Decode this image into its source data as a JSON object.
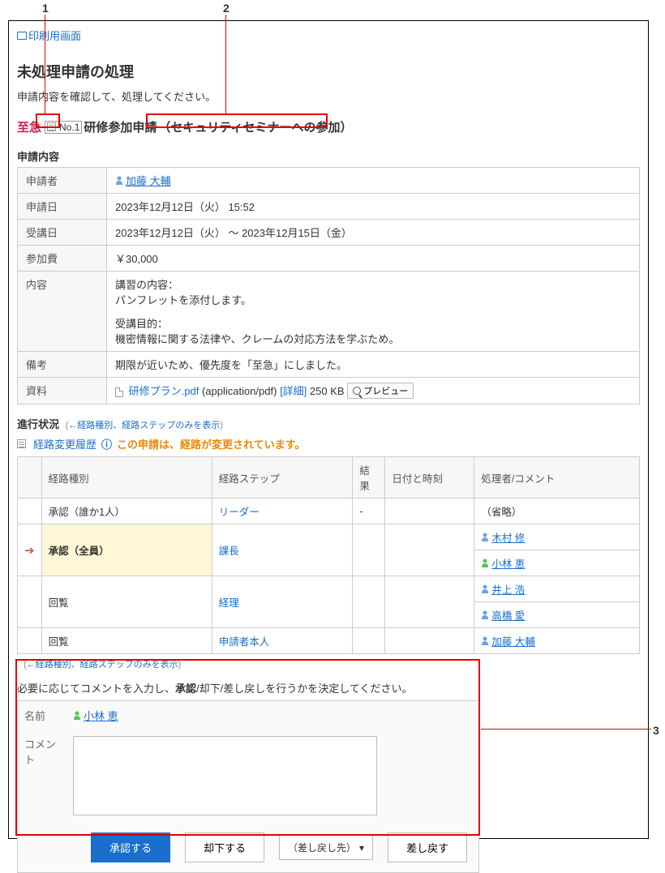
{
  "callouts": {
    "1": "1",
    "2": "2",
    "3": "3"
  },
  "print_link": "印刷用画面",
  "page_title": "未処理申請の処理",
  "page_desc": "申請内容を確認して、処理してください。",
  "request": {
    "urgent": "至急",
    "number": "No.1",
    "title": "研修参加申請",
    "subtitle": "（セキュリティセミナーへの参加）"
  },
  "details": {
    "heading": "申請内容",
    "rows": {
      "applicant_label": "申請者",
      "applicant_name": "加藤 大輔",
      "apply_date_label": "申請日",
      "apply_date": "2023年12月12日（火） 15:52",
      "attend_date_label": "受講日",
      "attend_date": "2023年12月12日（火） ～ 2023年12月15日（金）",
      "fee_label": "参加費",
      "fee": "￥30,000",
      "content_label": "内容",
      "content_line1": "講習の内容：",
      "content_line2": "パンフレットを添付します。",
      "content_line3": "受講目的：",
      "content_line4": "機密情報に関する法律や、クレームの対応方法を学ぶため。",
      "remarks_label": "備考",
      "remarks": "期限が近いため、優先度を「至急」にしました。",
      "material_label": "資料",
      "material_file": "研修プラン.pdf",
      "material_mime": "(application/pdf)",
      "material_detail": "[詳細]",
      "material_size": "250 KB",
      "material_preview": "プレビュー"
    }
  },
  "progress": {
    "heading": "進行状況",
    "collapse_link": "←経路種別、経路ステップのみを表示",
    "route_history": "経路変更履歴",
    "route_warn": "この申請は、経路が変更されています。",
    "cols": {
      "type": "経路種別",
      "step": "経路ステップ",
      "result": "結果",
      "datetime": "日付と時刻",
      "handler": "処理者/コメント"
    },
    "rows": [
      {
        "type": "承認（誰か1人）",
        "step": "リーダー",
        "result": "-",
        "handler": "（省略）",
        "current": false,
        "person": false
      },
      {
        "type": "承認（全員）",
        "step": "課長",
        "handlers": [
          "木村 修",
          "小林 恵"
        ],
        "current": true
      },
      {
        "type": "回覧",
        "step": "経理",
        "handlers": [
          "井上 浩",
          "高橋 愛"
        ],
        "current": false
      },
      {
        "type": "回覧",
        "step": "申請者本人",
        "handlers": [
          "加藤 大輔"
        ],
        "current": false
      }
    ],
    "collapse_link2": "←経路種別、経路ステップのみを表示"
  },
  "action": {
    "instruction_prefix": "必要に応じてコメントを入力し、",
    "instruction_bold": "承認",
    "instruction_suffix": "/却下/差し戻しを行うかを決定してください。",
    "name_label": "名前",
    "name_value": "小林 恵",
    "comment_label": "コメント",
    "approve": "承認する",
    "reject": "却下する",
    "remand_select": "（差し戻し先）",
    "remand": "差し戻す"
  },
  "colors": {
    "person_blue": "#6aa3e0",
    "person_green": "#5fbf5f"
  }
}
